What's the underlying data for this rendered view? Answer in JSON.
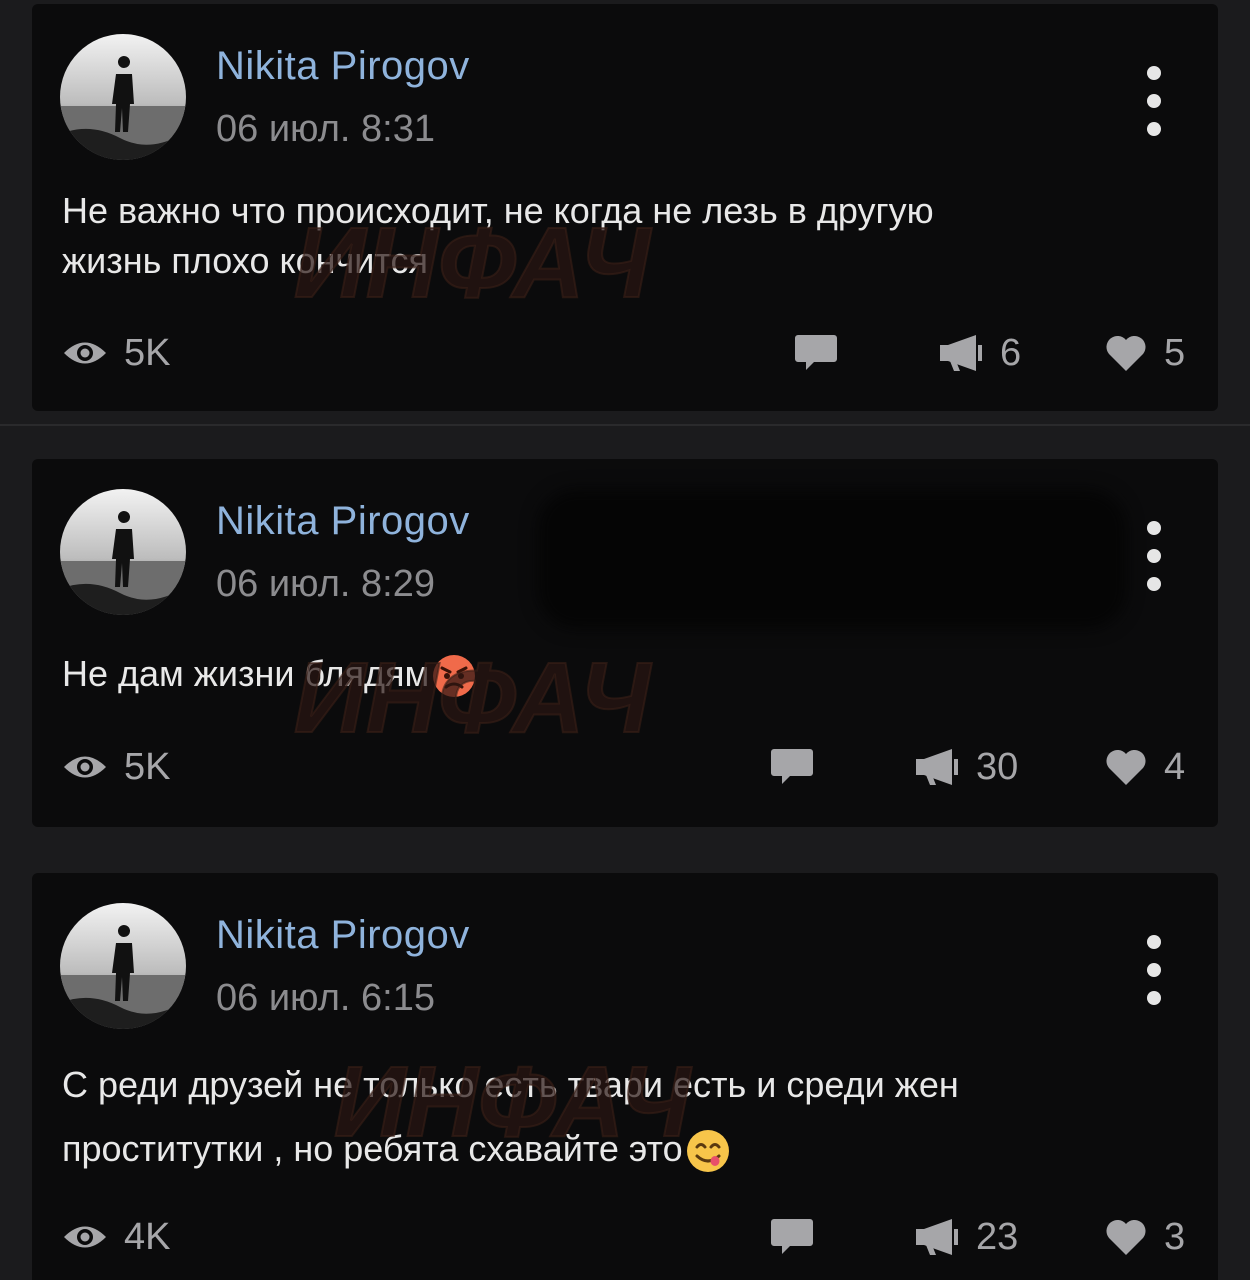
{
  "posts": [
    {
      "author": "Nikita Pirogov",
      "date": "06 июл. 8:31",
      "text_lines": [
        "Не важно что происходит, не когда не лезь в другую",
        "жизнь плохо кончится"
      ],
      "emoji": "",
      "views": "5K",
      "reposts": "6",
      "likes": "5"
    },
    {
      "author": "Nikita Pirogov",
      "date": "06 июл. 8:29",
      "text_lines": [
        "Не дам жизни блядям"
      ],
      "emoji": "angry-face",
      "views": "5K",
      "reposts": "30",
      "likes": "4"
    },
    {
      "author": "Nikita Pirogov",
      "date": "06 июл. 6:15",
      "text_lines": [
        "С реди друзей не только есть твари есть и среди жен",
        "проститутки , но ребята схавайте это"
      ],
      "emoji": "yummy-face",
      "views": "4K",
      "reposts": "23",
      "likes": "3"
    }
  ],
  "watermark": "ИНФАЧ",
  "colors": {
    "background": "#1b1b1d",
    "card": "#0b0b0c",
    "author": "#8fb3dc",
    "muted": "#8c8c8f",
    "text": "#e8e8e8"
  }
}
